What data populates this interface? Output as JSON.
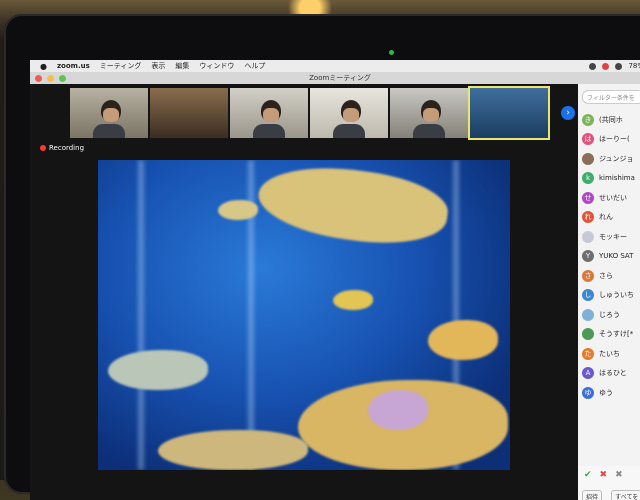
{
  "menubar": {
    "app": "zoom.us",
    "items": [
      "ミーティング",
      "表示",
      "編集",
      "ウィンドウ",
      "ヘルプ"
    ],
    "battery": "78%"
  },
  "window": {
    "title": "Zoomミーティング"
  },
  "recording": {
    "label": "Recording"
  },
  "panel": {
    "filter_placeholder": "フィルター条件を",
    "participants": [
      {
        "name": "(共同ホ",
        "initial": "き",
        "color": "#7cb45a"
      },
      {
        "name": "はーりー(",
        "initial": "は",
        "color": "#e0527a"
      },
      {
        "name": "ジュンジョ",
        "initial": "",
        "color": "#8a6f58"
      },
      {
        "name": "kimishima",
        "initial": "k",
        "color": "#3fae6c"
      },
      {
        "name": "せいだい",
        "initial": "せ",
        "color": "#b146c2"
      },
      {
        "name": "れん",
        "initial": "れ",
        "color": "#e0553a"
      },
      {
        "name": "モッキー",
        "initial": "",
        "color": "#c6c9d6"
      },
      {
        "name": "YUKO SAT",
        "initial": "Y",
        "color": "#6f6f6f"
      },
      {
        "name": "さら",
        "initial": "さ",
        "color": "#d8783a"
      },
      {
        "name": "しゅういち",
        "initial": "し",
        "color": "#3b87d4"
      },
      {
        "name": "じろう",
        "initial": "",
        "color": "#7fb0d8"
      },
      {
        "name": "そうすけ[*",
        "initial": "",
        "color": "#4e9a55"
      },
      {
        "name": "たいち",
        "initial": "た",
        "color": "#e77a2a"
      },
      {
        "name": "はるひと",
        "initial": "A",
        "color": "#6a5ad1"
      },
      {
        "name": "ゆう",
        "initial": "ゆ",
        "color": "#3c6ed8"
      }
    ],
    "footer_buttons": [
      "招待",
      "すべてを"
    ]
  }
}
